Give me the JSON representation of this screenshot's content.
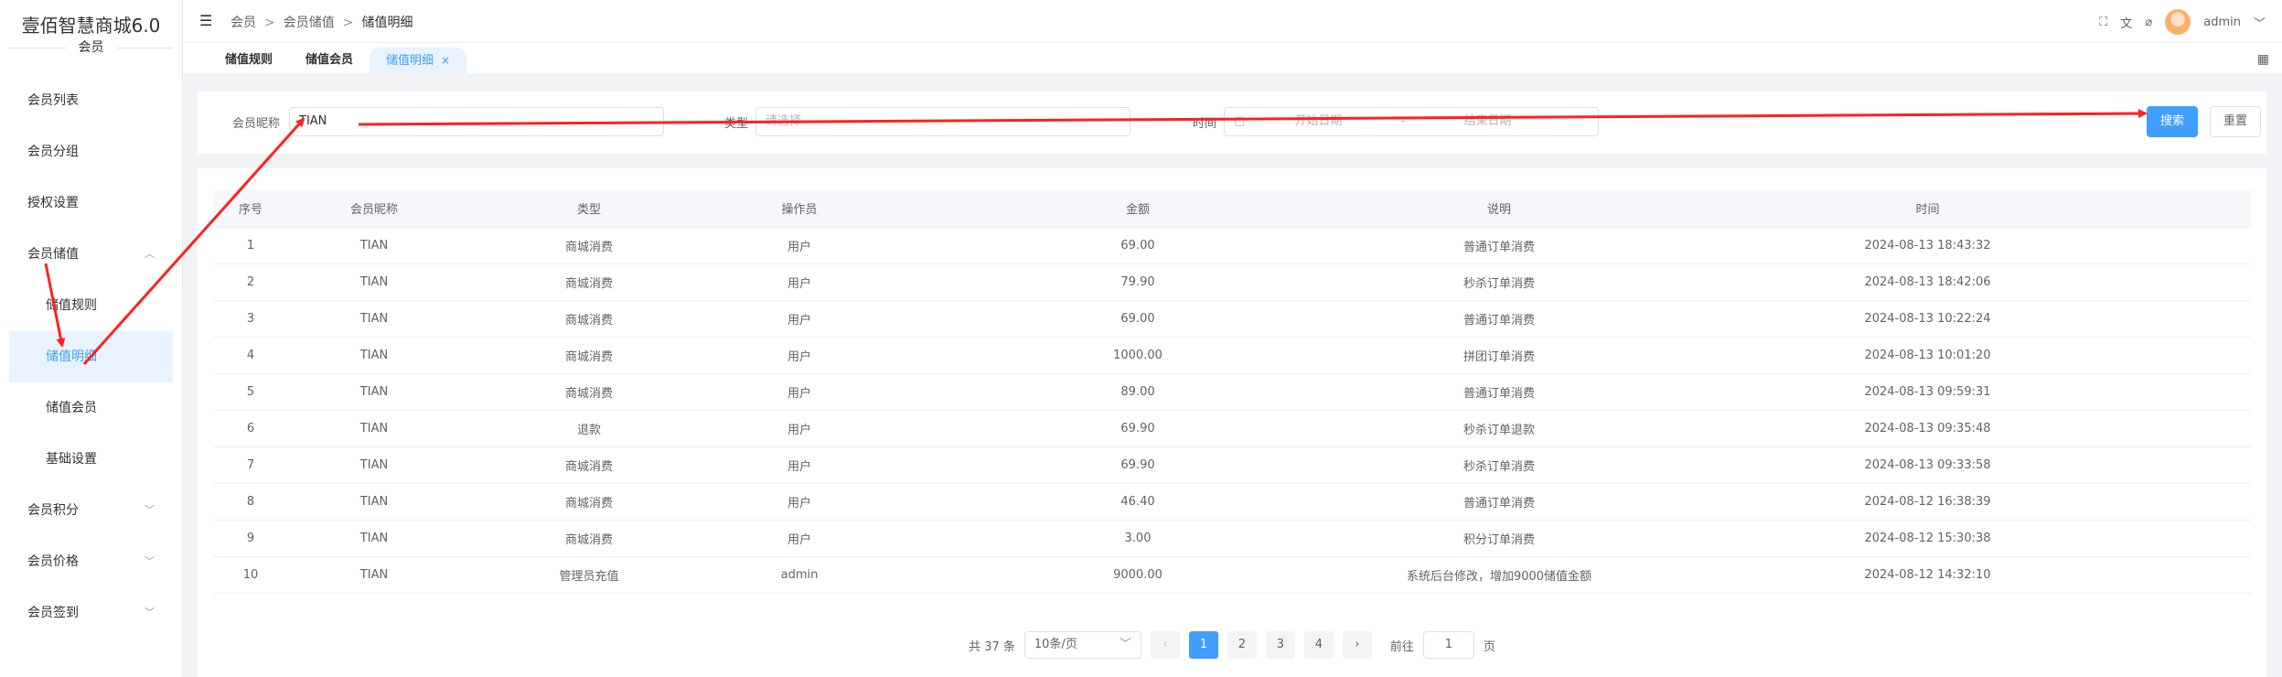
{
  "app": {
    "title": "壹佰智慧商城6.0",
    "section": "会员"
  },
  "sidebar": {
    "items": [
      {
        "label": "会员列表"
      },
      {
        "label": "会员分组"
      },
      {
        "label": "授权设置"
      },
      {
        "label": "会员储值",
        "expanded": true,
        "children": [
          {
            "label": "储值规则"
          },
          {
            "label": "储值明细",
            "active": true
          },
          {
            "label": "储值会员"
          },
          {
            "label": "基础设置"
          }
        ]
      },
      {
        "label": "会员积分"
      },
      {
        "label": "会员价格"
      },
      {
        "label": "会员签到"
      }
    ]
  },
  "header": {
    "breadcrumb": [
      "会员",
      "会员储值",
      "储值明细"
    ],
    "user": "admin"
  },
  "tabs": [
    {
      "label": "储值规则"
    },
    {
      "label": "储值会员"
    },
    {
      "label": "储值明细",
      "active": true
    }
  ],
  "filters": {
    "nickname_label": "会员昵称",
    "nickname_value": "TIAN",
    "type_label": "类型",
    "type_placeholder": "请选择",
    "time_label": "时间",
    "start_placeholder": "开始日期",
    "range_sep": "-",
    "end_placeholder": "结束日期",
    "search_label": "搜索",
    "reset_label": "重置"
  },
  "table": {
    "columns": [
      "序号",
      "会员昵称",
      "类型",
      "操作员",
      "金额",
      "说明",
      "时间"
    ],
    "rows": [
      [
        "1",
        "TIAN",
        "商城消费",
        "用户",
        "69.00",
        "普通订单消费",
        "2024-08-13 18:43:32"
      ],
      [
        "2",
        "TIAN",
        "商城消费",
        "用户",
        "79.90",
        "秒杀订单消费",
        "2024-08-13 18:42:06"
      ],
      [
        "3",
        "TIAN",
        "商城消费",
        "用户",
        "69.00",
        "普通订单消费",
        "2024-08-13 10:22:24"
      ],
      [
        "4",
        "TIAN",
        "商城消费",
        "用户",
        "1000.00",
        "拼团订单消费",
        "2024-08-13 10:01:20"
      ],
      [
        "5",
        "TIAN",
        "商城消费",
        "用户",
        "89.00",
        "普通订单消费",
        "2024-08-13 09:59:31"
      ],
      [
        "6",
        "TIAN",
        "退款",
        "用户",
        "69.90",
        "秒杀订单退款",
        "2024-08-13 09:35:48"
      ],
      [
        "7",
        "TIAN",
        "商城消费",
        "用户",
        "69.90",
        "秒杀订单消费",
        "2024-08-13 09:33:58"
      ],
      [
        "8",
        "TIAN",
        "商城消费",
        "用户",
        "46.40",
        "普通订单消费",
        "2024-08-12 16:38:39"
      ],
      [
        "9",
        "TIAN",
        "商城消费",
        "用户",
        "3.00",
        "积分订单消费",
        "2024-08-12 15:30:38"
      ],
      [
        "10",
        "TIAN",
        "管理员充值",
        "admin",
        "9000.00",
        "系统后台修改，增加9000储值金额",
        "2024-08-12 14:32:10"
      ]
    ]
  },
  "pagination": {
    "total_text": "共 37 条",
    "page_size": "10条/页",
    "pages": [
      "1",
      "2",
      "3",
      "4"
    ],
    "current": "1",
    "goto_label": "前往",
    "goto_value": "1",
    "goto_suffix": "页"
  },
  "annotation_color": "#ff0000"
}
